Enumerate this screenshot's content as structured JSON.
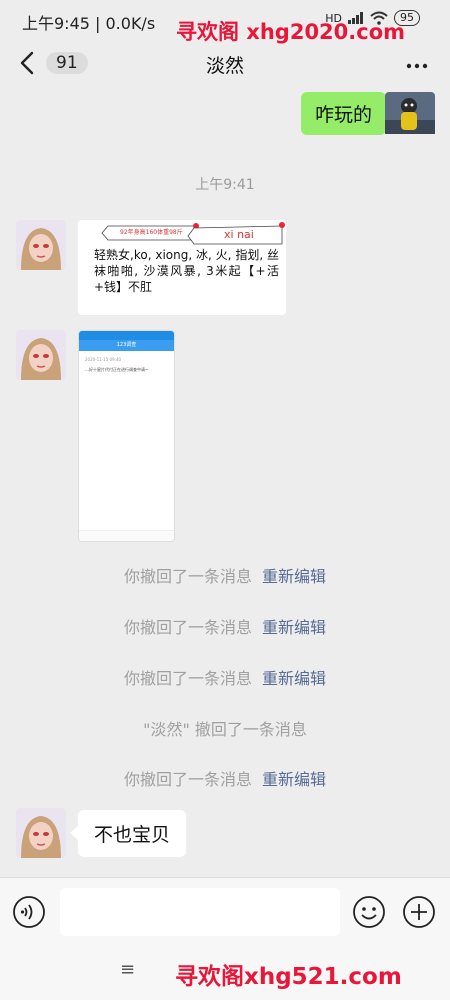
{
  "status_bar": {
    "time_speed": "上午9:45 | 0.0K/s",
    "network": "HD",
    "battery": "95"
  },
  "watermark": {
    "top": "寻欢阁 xhg2020.com",
    "bottom": "寻欢阁xhg521.com"
  },
  "header": {
    "unread_count": "91",
    "title": "淡然"
  },
  "messages": {
    "outgoing_text": "咋玩的",
    "timestamp": "上午9:41",
    "image1": {
      "tag_small": "92年身高160体重98斤",
      "tag_name": "xi nai",
      "text": "轻熟女,ko, xiong, 冰, 火, 指划, 丝袜啪啪, 沙漠风暴, 3米起【+活+钱】不肛"
    },
    "image2": {
      "title": "123调查",
      "line1": "2020-11-15 09:40",
      "line2": "…好十星片代付正在进行调查中请~"
    }
  },
  "recall": {
    "you_recalled": "你撤回了一条消息",
    "re_edit": "重新编辑",
    "other_recalled": "\"淡然\" 撤回了一条消息"
  },
  "incoming_text": "不也宝贝",
  "input": {
    "placeholder": ""
  },
  "bottom_nav": {
    "menu_glyph": "≡"
  }
}
